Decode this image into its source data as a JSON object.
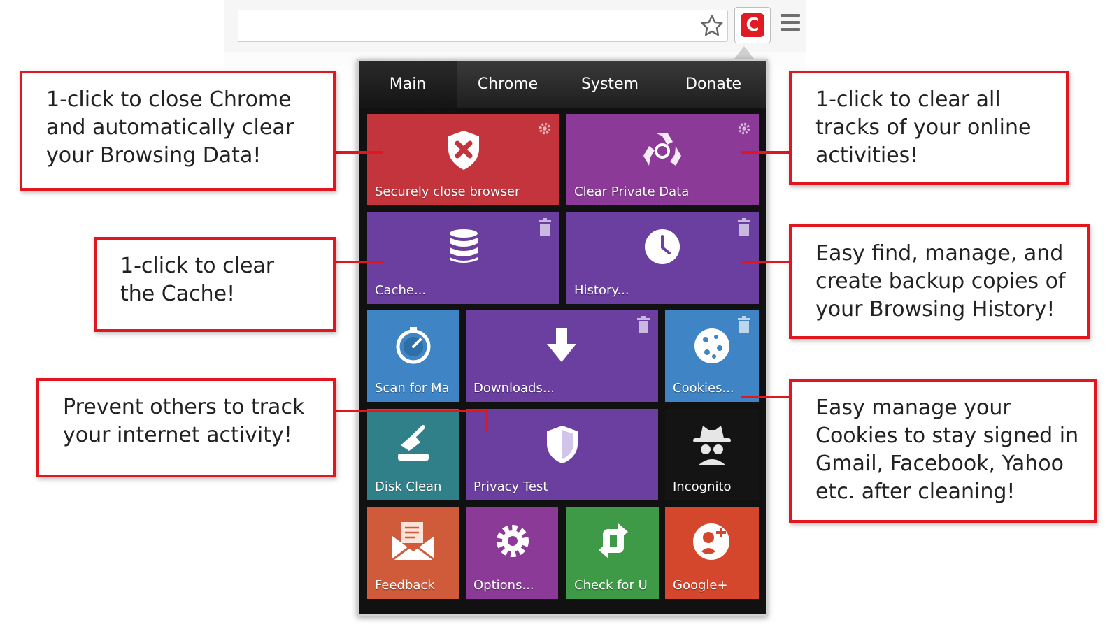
{
  "toolbar": {
    "star_icon": "star-outline-icon",
    "extension_logo": "C",
    "extension_color": "#e01b23",
    "menu_icon": "hamburger-menu-icon"
  },
  "popup": {
    "tabs": [
      {
        "label": "Main",
        "active": true
      },
      {
        "label": "Chrome",
        "active": false
      },
      {
        "label": "System",
        "active": false
      },
      {
        "label": "Donate",
        "active": false
      }
    ],
    "tiles": {
      "secure_close": {
        "label": "Securely close browser",
        "icon": "shield-x-icon",
        "corner": "gear-icon",
        "color": "#c3343c"
      },
      "clear_private": {
        "label": "Clear Private Data",
        "icon": "recycle-icon",
        "corner": "gear-icon",
        "color": "#8b3b97"
      },
      "cache": {
        "label": "Cache...",
        "icon": "database-icon",
        "corner": "trash-icon",
        "color": "#6a3fa0"
      },
      "history": {
        "label": "History...",
        "icon": "clock-icon",
        "corner": "trash-icon",
        "color": "#6a3fa0"
      },
      "scan": {
        "label": "Scan for Ma",
        "icon": "gauge-icon",
        "color": "#3f84c4"
      },
      "downloads": {
        "label": "Downloads...",
        "icon": "download-arrow-icon",
        "corner": "trash-icon",
        "color": "#6a3fa0"
      },
      "cookies": {
        "label": "Cookies...",
        "icon": "cookie-icon",
        "corner": "trash-icon",
        "color": "#3f84c4"
      },
      "disk_clean": {
        "label": "Disk Clean",
        "icon": "broom-icon",
        "color": "#2f8088"
      },
      "privacy_test": {
        "label": "Privacy Test",
        "icon": "shield-icon",
        "color": "#6a3fa0"
      },
      "incognito": {
        "label": "Incognito",
        "icon": "incognito-spy-icon",
        "color": "#141414"
      },
      "feedback": {
        "label": "Feedback",
        "icon": "envelope-icon",
        "color": "#cf5b3b"
      },
      "options": {
        "label": "Options...",
        "icon": "gear-icon",
        "color": "#8b3b97"
      },
      "check_update": {
        "label": "Check for U",
        "icon": "refresh-arrows-icon",
        "color": "#3e9a47"
      },
      "google_plus": {
        "label": "Google+",
        "icon": "google-plus-icon",
        "color": "#d5472d"
      }
    }
  },
  "callouts": {
    "close_chrome": [
      "1-click to close Chrome",
      "and automatically clear",
      "your Browsing Data!"
    ],
    "clear_tracks": [
      "1-click to clear all",
      "tracks of your online",
      "activities!"
    ],
    "clear_cache": [
      "1-click to clear",
      "the Cache!"
    ],
    "history": [
      "Easy find, manage, and",
      "create backup copies of",
      "your Browsing History!"
    ],
    "privacy": [
      "Prevent others to track",
      "your internet activity!"
    ],
    "cookies": [
      "Easy manage your",
      "Cookies to stay signed in",
      "Gmail, Facebook, Yahoo",
      "etc. after cleaning!"
    ]
  },
  "accent_color": "#e2161e"
}
